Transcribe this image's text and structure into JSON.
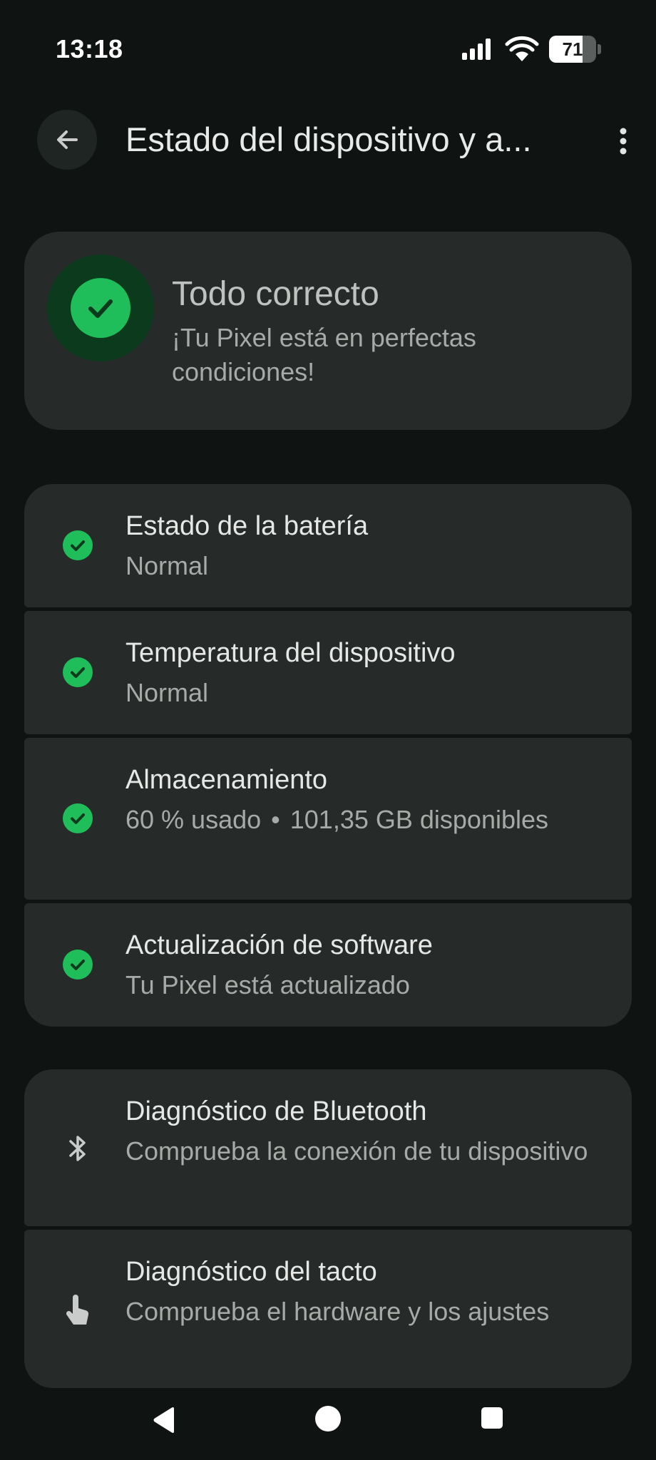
{
  "status_bar": {
    "time": "13:18",
    "battery_level": "71",
    "battery_fraction": 0.71,
    "icons": [
      "signal-icon",
      "wifi-icon",
      "battery-icon"
    ]
  },
  "app_bar": {
    "title": "Estado del dispositivo y a...",
    "icons": [
      "arrow-back-icon",
      "more-vert-icon"
    ]
  },
  "summary": {
    "title": "Todo correcto",
    "subtitle": "¡Tu Pixel está en perfectas condiciones!",
    "icon": "check-circle-icon"
  },
  "status_items": [
    {
      "title": "Estado de la batería",
      "subtitle": "Normal",
      "icon": "check-circle-icon"
    },
    {
      "title": "Temperatura del dispositivo",
      "subtitle": "Normal",
      "icon": "check-circle-icon"
    },
    {
      "title": "Almacenamiento",
      "subtitle_used": "60 % usado",
      "separator": "•",
      "subtitle_free": "101,35 GB disponibles",
      "icon": "check-circle-icon"
    },
    {
      "title": "Actualización de software",
      "subtitle": "Tu Pixel está actualizado",
      "icon": "check-circle-icon"
    }
  ],
  "diagnostics": [
    {
      "title": "Diagnóstico de Bluetooth",
      "subtitle": "Comprueba la conexión de tu dispositivo",
      "icon": "bluetooth-icon"
    },
    {
      "title": "Diagnóstico del tacto",
      "subtitle": "Comprueba el hardware y los ajustes",
      "icon": "touch-icon"
    }
  ],
  "nav_bar": {
    "icons": [
      "nav-back-icon",
      "nav-home-icon",
      "nav-recents-icon"
    ]
  },
  "colors": {
    "background": "#0f1412",
    "card": "#262b29",
    "success": "#1fbe5a",
    "success_dark": "#0b3a1c"
  }
}
